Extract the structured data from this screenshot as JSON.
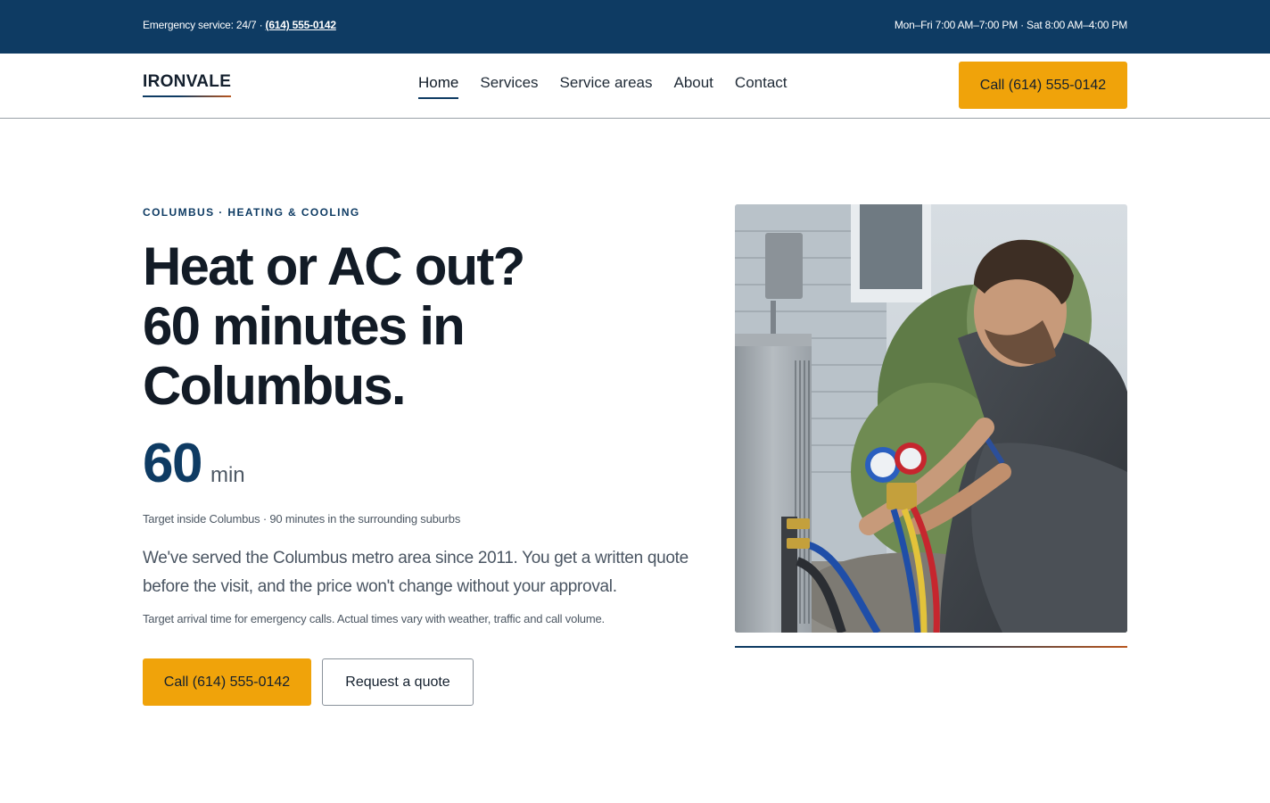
{
  "topbar": {
    "emergency_prefix": "Emergency service: 24/7 · ",
    "emergency_phone": "(614) 555-0142",
    "hours": "Mon–Fri 7:00 AM–7:00 PM · Sat 8:00 AM–4:00 PM"
  },
  "header": {
    "logo": "IRONVALE",
    "nav": [
      {
        "label": "Home",
        "active": true
      },
      {
        "label": "Services",
        "active": false
      },
      {
        "label": "Service areas",
        "active": false
      },
      {
        "label": "About",
        "active": false
      },
      {
        "label": "Contact",
        "active": false
      }
    ],
    "cta_label": "Call (614) 555-0142"
  },
  "hero": {
    "eyebrow": "COLUMBUS · HEATING & COOLING",
    "headline_lines": [
      "Heat or AC out?",
      "60 minutes in",
      "Columbus."
    ],
    "stat_value": "60",
    "stat_unit": "min",
    "stat_note": "Target inside Columbus · 90 minutes in the surrounding suburbs",
    "lead": "We've served the Columbus metro area since 2011. You get a written quote before the visit, and the price won't change without your approval.",
    "disclaimer": "Target arrival time for emergency calls. Actual times vary with weather, traffic and call volume.",
    "primary_cta": "Call (614) 555-0142",
    "secondary_cta": "Request a quote"
  },
  "colors": {
    "brand_navy": "#0e3b63",
    "accent_amber": "#f0a30a",
    "accent_rust": "#b8561e"
  }
}
